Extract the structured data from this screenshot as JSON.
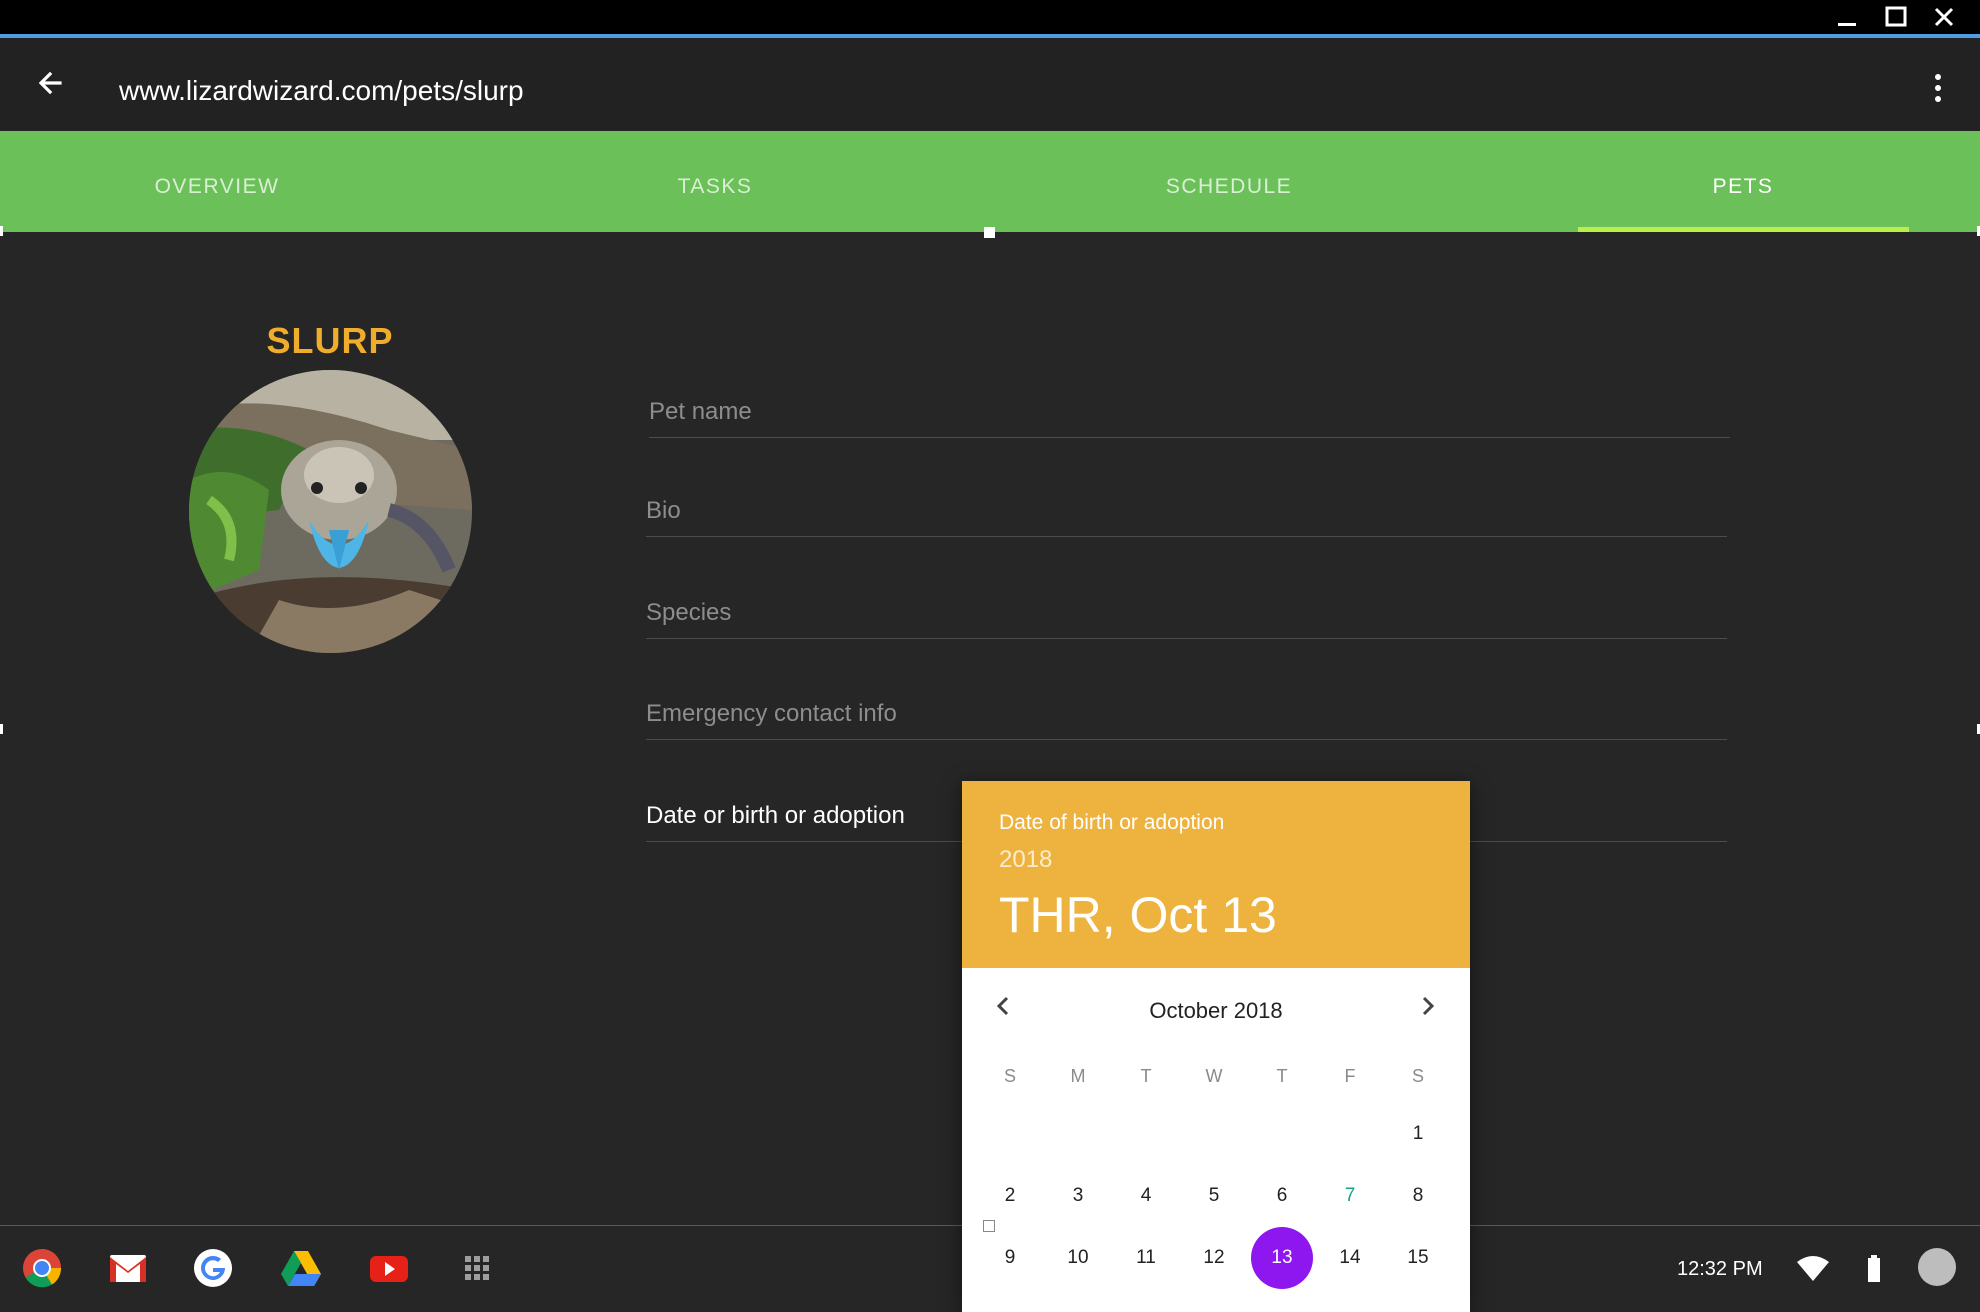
{
  "window": {
    "minimize_icon": "minimize-icon",
    "maximize_icon": "maximize-icon",
    "close_icon": "close-icon"
  },
  "addressbar": {
    "url": "www.lizardwizard.com/pets/slurp",
    "back_icon": "arrow-back-icon",
    "menu_icon": "more-vert-icon"
  },
  "tabs": [
    {
      "label": "OVERVIEW",
      "active": false
    },
    {
      "label": "TASKS",
      "active": false
    },
    {
      "label": "SCHEDULE",
      "active": false
    },
    {
      "label": "PETS",
      "active": true
    }
  ],
  "pet": {
    "title": "SLURP",
    "avatar": "blue-tongue-lizard-photo"
  },
  "form": {
    "pet_name": "Pet name",
    "bio": "Bio",
    "species": "Species",
    "emergency": "Emergency contact info",
    "date": "Date or birth or adoption"
  },
  "picker": {
    "label": "Date of birth or adoption",
    "year": "2018",
    "date": "THR, Oct 13",
    "month": "October 2018",
    "weekdays": [
      "S",
      "M",
      "T",
      "W",
      "T",
      "F",
      "S"
    ],
    "week1": [
      "1"
    ],
    "week2": [
      "2",
      "3",
      "4",
      "5",
      "6",
      "7",
      "8"
    ],
    "week3": [
      "9",
      "10",
      "11",
      "12",
      "13",
      "14",
      "15"
    ],
    "today": "7",
    "selected": "13"
  },
  "shelf": {
    "apps": [
      "chrome-icon",
      "gmail-icon",
      "google-icon",
      "drive-icon",
      "youtube-icon",
      "launcher-icon"
    ],
    "time": "12:32 PM",
    "tray": [
      "wifi-icon",
      "battery-icon",
      "account-avatar"
    ]
  },
  "colors": {
    "tab_bar": "#6cc05a",
    "tab_indicator": "#b9ef4a",
    "accent": "#eeb33f",
    "pet_title": "#f0ad2b",
    "selected_day": "#8e16ef",
    "today": "#1aa38a"
  }
}
